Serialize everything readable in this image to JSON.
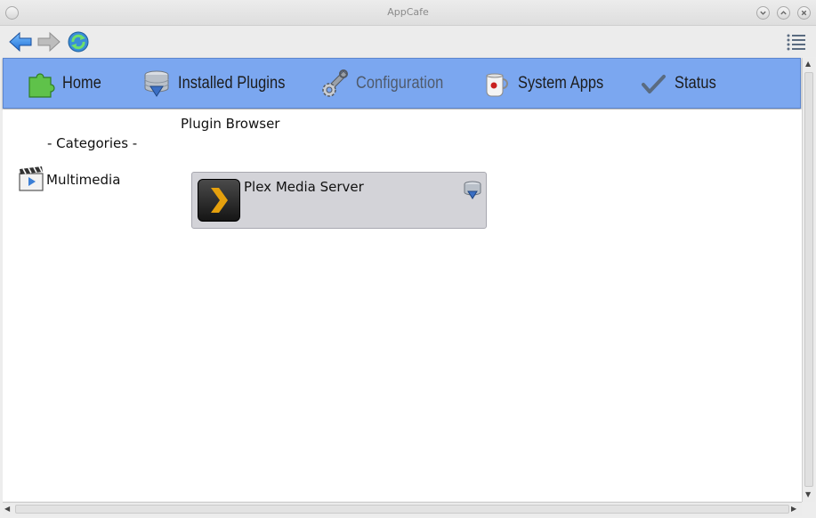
{
  "window": {
    "title": "AppCafe"
  },
  "toolbar": {
    "back": "back-arrow-icon",
    "forward": "forward-arrow-icon",
    "refresh": "refresh-icon",
    "menu": "hamburger-menu-icon"
  },
  "tabs": [
    {
      "label": "Home",
      "icon": "puzzle-piece-icon",
      "active": false
    },
    {
      "label": "Installed Plugins",
      "icon": "installed-drive-icon",
      "active": false
    },
    {
      "label": "Configuration",
      "icon": "wrench-gear-icon",
      "active": true
    },
    {
      "label": "System Apps",
      "icon": "coffee-cup-icon",
      "active": false
    },
    {
      "label": "Status",
      "icon": "checkmark-icon",
      "active": false
    }
  ],
  "sidebar": {
    "header": "- Categories -",
    "items": [
      {
        "label": "Multimedia",
        "icon": "clapperboard-icon"
      }
    ]
  },
  "browser": {
    "title": "Plugin Browser",
    "plugins": [
      {
        "name": "Plex Media Server",
        "icon": "plex-logo-icon",
        "status_icon": "installed-drive-icon"
      }
    ]
  },
  "colors": {
    "tabbar": "#7ba7f0",
    "card": "#d3d3d8",
    "plex_accent": "#e5a00d"
  }
}
